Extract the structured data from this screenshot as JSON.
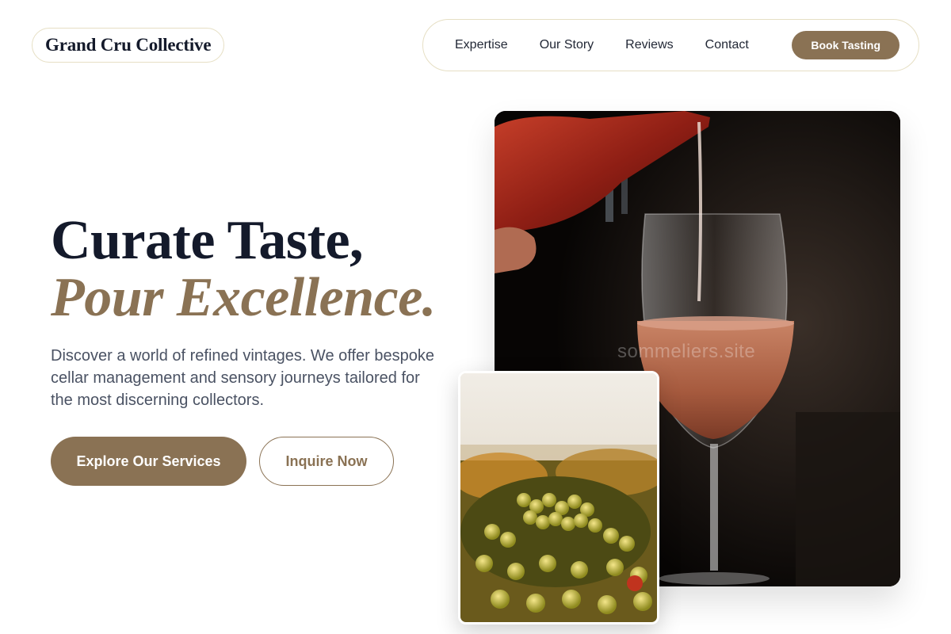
{
  "brand": {
    "name": "Grand Cru Collective"
  },
  "nav": {
    "links": [
      "Expertise",
      "Our Story",
      "Reviews",
      "Contact"
    ],
    "cta": "Book Tasting"
  },
  "hero": {
    "title_line1": "Curate Taste,",
    "title_line2": "Pour Excellence.",
    "description": "Discover a world of refined vintages. We offer bespoke cellar management and sensory journeys tailored for the most discerning collectors.",
    "primary_button": "Explore Our Services",
    "secondary_button": "Inquire Now"
  },
  "images": {
    "main_watermark": "sommeliers.site",
    "main_alt": "Rosé wine being poured into a glass",
    "secondary_alt": "Grape clusters in a vineyard"
  },
  "colors": {
    "accent": "#8a7254",
    "heading": "#141a2b",
    "body_text": "#4a5263",
    "pill_border": "#e6dfc4"
  }
}
